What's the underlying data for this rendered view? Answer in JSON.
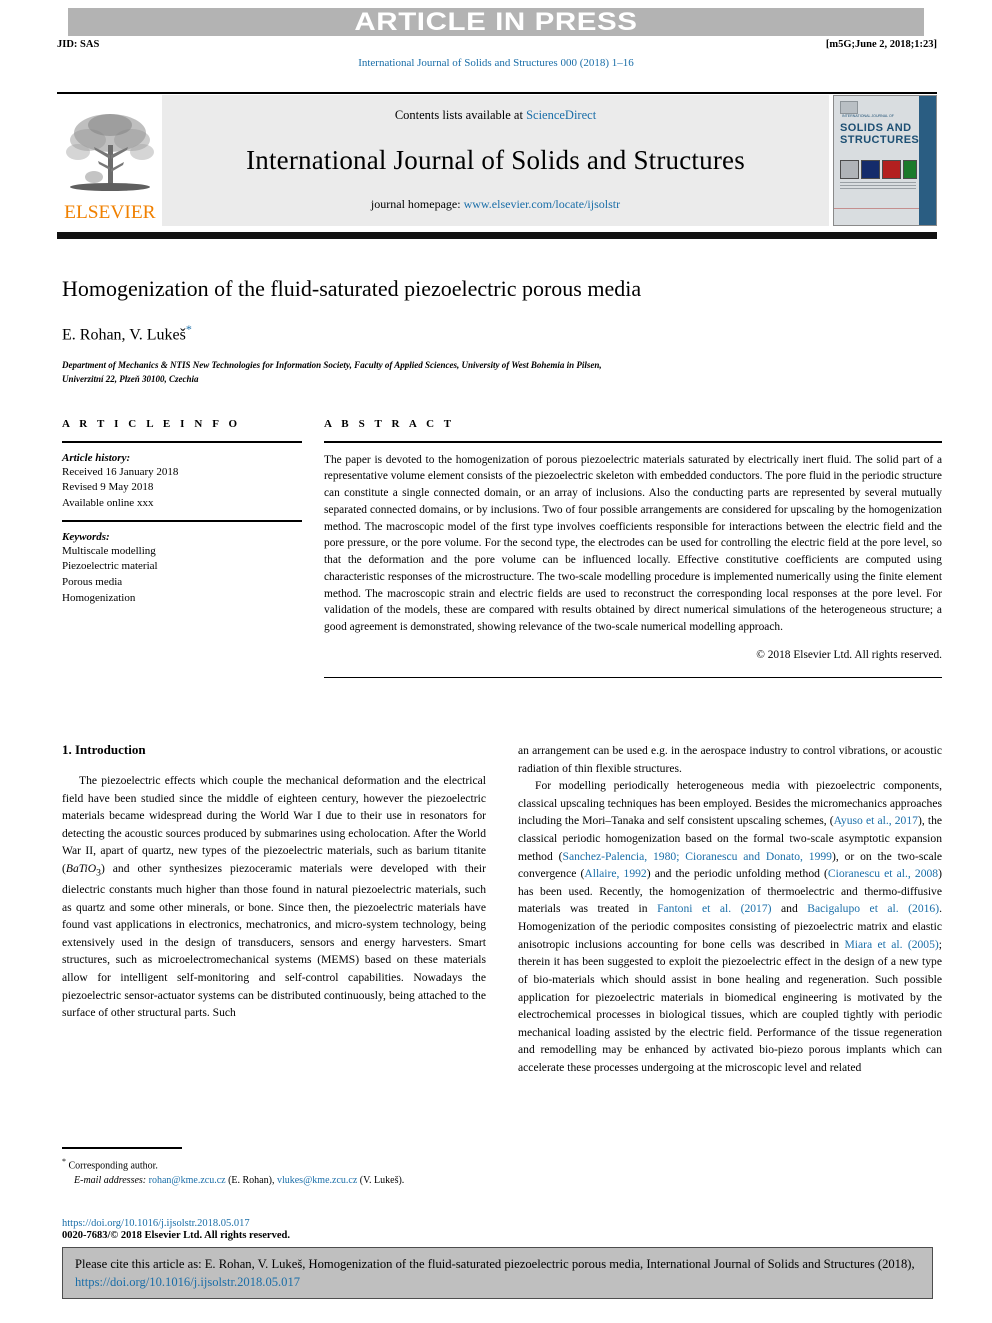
{
  "banner": {
    "press_text": "ARTICLE IN PRESS",
    "jid": "JID: SAS",
    "stamp": "[m5G;June 2, 2018;1:23]",
    "journal_ref": "International Journal of Solids and Structures 000 (2018) 1–16"
  },
  "masthead": {
    "contents_prefix": "Contents lists available at ",
    "sciencedirect": "ScienceDirect",
    "journal_title": "International Journal of Solids and Structures",
    "homepage_prefix": "journal homepage: ",
    "homepage_url": "www.elsevier.com/locate/ijsolstr",
    "publisher": "ELSEVIER",
    "cover": {
      "supra": "INTERNATIONAL JOURNAL OF",
      "line1": "SOLIDS AND",
      "line2": "STRUCTURES"
    }
  },
  "article": {
    "title": "Homogenization of the fluid-saturated piezoelectric porous media",
    "authors": "E. Rohan, V. Lukeš",
    "corresponding_marker": "*",
    "affiliation_line1": "Department of Mechanics & NTIS New Technologies for Information Society, Faculty of Applied Sciences, University of West Bohemia in Pilsen,",
    "affiliation_line2": "Univerzitní 22, Plzeň 30100, Czechia"
  },
  "info": {
    "heading": "A R T I C L E  I N F O",
    "history_label": "Article history:",
    "history": [
      "Received 16 January 2018",
      "Revised 9 May 2018",
      "Available online xxx"
    ],
    "keywords_label": "Keywords:",
    "keywords": [
      "Multiscale modelling",
      "Piezoelectric material",
      "Porous media",
      "Homogenization"
    ]
  },
  "abstract": {
    "heading": "A B S T R A C T",
    "text": "The paper is devoted to the homogenization of porous piezoelectric materials saturated by electrically inert fluid. The solid part of a representative volume element consists of the piezoelectric skeleton with embedded conductors. The pore fluid in the periodic structure can constitute a single connected domain, or an array of inclusions. Also the conducting parts are represented by several mutually separated connected domains, or by inclusions. Two of four possible arrangements are considered for upscaling by the homogenization method. The macroscopic model of the first type involves coefficients responsible for interactions between the electric field and the pore pressure, or the pore volume. For the second type, the electrodes can be used for controlling the electric field at the pore level, so that the deformation and the pore volume can be influenced locally. Effective constitutive coefficients are computed using characteristic responses of the microstructure. The two-scale modelling procedure is implemented numerically using the finite element method. The macroscopic strain and electric fields are used to reconstruct the corresponding local responses at the pore level. For validation of the models, these are compared with results obtained by direct numerical simulations of the heterogeneous structure; a good agreement is demonstrated, showing relevance of the two-scale numerical modelling approach.",
    "copyright": "© 2018 Elsevier Ltd. All rights reserved."
  },
  "body": {
    "section_title": "1. Introduction",
    "left_para_1": "The piezoelectric effects which couple the mechanical deformation and the electrical field have been studied since the middle of eighteen century, however the piezoelectric materials became widespread during the World War I due to their use in resonators for detecting the acoustic sources produced by submarines using echolocation. After the World War II, apart of quartz, new types of the piezoelectric materials, such as barium titanite (",
    "left_para_1_italic": "BaTiO",
    "left_para_1_sub": "3",
    "left_para_1_cont": ") and other synthesizes piezoceramic materials were developed with their dielectric constants much higher than those found in natural piezoelectric materials, such as quartz and some other minerals, or bone. Since then, the piezoelectric materials have found vast applications in electronics, mechatronics, and micro-system technology, being extensively used in the design of transducers, sensors and energy harvesters. Smart structures, such as microelectromechanical systems (MEMS) based on these materials allow for intelligent self-monitoring and self-control capabilities. Nowadays the piezoelectric sensor-actuator systems can be distributed continuously, being attached to the surface of other structural parts. Such",
    "right_para_1": "an arrangement can be used e.g. in the aerospace industry to control vibrations, or acoustic radiation of thin flexible structures.",
    "right_para_2_a": "For modelling periodically heterogeneous media with piezoelectric components, classical upscaling techniques has been employed. Besides the micromechanics approaches including the Mori–Tanaka and self consistent upscaling schemes, (",
    "right_cite_1": "Ayuso et al., 2017",
    "right_para_2_b": "), the classical periodic homogenization based on the formal two-scale asymptotic expansion method (",
    "right_cite_2": "Sanchez-Palencia, 1980; Cioranescu and Donato, 1999",
    "right_para_2_c": "), or on the two-scale convergence (",
    "right_cite_3": "Allaire, 1992",
    "right_para_2_d": ") and the periodic unfolding method (",
    "right_cite_4": "Cioranescu et al., 2008",
    "right_para_2_e": ") has been used. Recently, the homogenization of thermoelectric and thermo-diffusive materials was treated in ",
    "right_cite_5": "Fantoni et al. (2017)",
    "right_para_2_f": " and ",
    "right_cite_6": "Bacigalupo et al. (2016)",
    "right_para_2_g": ". Homogenization of the periodic composites consisting of piezoelectric matrix and elastic anisotropic inclusions accounting for bone cells was described in ",
    "right_cite_7": "Miara et al. (2005)",
    "right_para_2_h": "; therein it has been suggested to exploit the piezoelectric effect in the design of a new type of bio-materials which should assist in bone healing and regeneration. Such possible application for piezoelectric materials in biomedical engineering is motivated by the electrochemical processes in biological tissues, which are coupled tightly with periodic mechanical loading assisted by the electric field. Performance of the tissue regeneration and remodelling may be enhanced by activated bio-piezo porous implants which can accelerate these processes undergoing at the microscopic level and related"
  },
  "footnote": {
    "corresponding": "Corresponding author.",
    "emails_label": "E-mail addresses:",
    "email_1": "rohan@kme.zcu.cz",
    "email_1_owner": "(E. Rohan),",
    "email_2": "vlukes@kme.zcu.cz",
    "email_2_owner": "(V. Lukeš).",
    "doi": "https://doi.org/10.1016/j.ijsolstr.2018.05.017",
    "issn": "0020-7683/© 2018 Elsevier Ltd. All rights reserved."
  },
  "cite_box": {
    "text_a": "Please cite this article as: E. Rohan, V. Lukeš, Homogenization of the fluid-saturated piezoelectric porous media, International Journal of Solids and Structures (2018), ",
    "link": "https://doi.org/10.1016/j.ijsolstr.2018.05.017"
  },
  "colors": {
    "link": "#1a6ea8",
    "banner_bg": "#b3b3b3",
    "masthead_bg": "#ebebeb",
    "elsevier_orange": "#f08000",
    "cite_box_bg": "#bfbfbf"
  }
}
